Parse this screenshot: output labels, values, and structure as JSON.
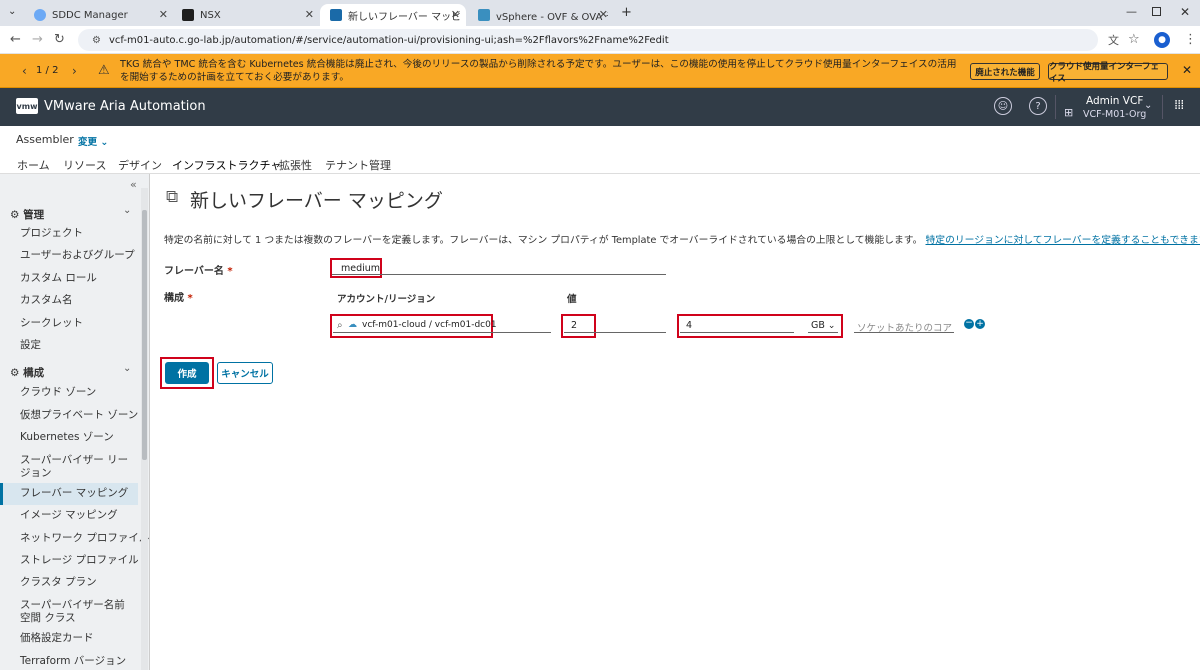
{
  "browser": {
    "tabs": [
      {
        "title": "SDDC Manager",
        "color": "#6ca9f5"
      },
      {
        "title": "NSX",
        "color": "#1e1e1e"
      },
      {
        "title": "新しいフレーバー マッピング - Assem",
        "color": "#1a6aa8"
      },
      {
        "title": "vSphere - OVF & OVA テンプレー",
        "color": "#3a8fbf"
      }
    ],
    "url": "vcf-m01-auto.c.go-lab.jp/automation/#/service/automation-ui/provisioning-ui;ash=%2Fflavors%2Fname%2Fedit"
  },
  "banner": {
    "counter": "1 / 2",
    "message": "TKG 統合や TMC 統合を含む Kubernetes 統合機能は廃止され、今後のリリースの製品から削除される予定です。ユーザーは、この機能の使用を停止してクラウド使用量インターフェイスの活用を開始するための計画を立てておく必要があります。",
    "button1": "廃止された機能",
    "button2": "クラウド使用量インターフェイス"
  },
  "header": {
    "logo": "vmw",
    "title": "VMware Aria Automation",
    "user": "Admin VCF",
    "org": "VCF-M01-Org"
  },
  "service": {
    "name": "Assembler",
    "change": "変更",
    "tabs": [
      "ホーム",
      "リソース",
      "デザイン",
      "インフラストラクチャ",
      "拡張性",
      "テナント管理"
    ]
  },
  "sidebar": {
    "section1": "管理",
    "items1": [
      "プロジェクト",
      "ユーザーおよびグループ",
      "カスタム ロール",
      "カスタム名",
      "シークレット",
      "設定"
    ],
    "section2": "構成",
    "items2": [
      "クラウド ゾーン",
      "仮想プライベート ゾーン",
      "Kubernetes ゾーン",
      "スーパーバイザー リージョン",
      "フレーバー マッピング",
      "イメージ マッピング",
      "ネットワーク プロファイル",
      "ストレージ プロファイル",
      "クラスタ プラン",
      "スーパーバイザー名前空間 クラス",
      "価格設定カード",
      "Terraform バージョン"
    ]
  },
  "form": {
    "title": "新しいフレーバー マッピング",
    "description": "特定の名前に対して 1 つまたは複数のフレーバーを定義します。フレーバーは、マシン プロパティが Template でオーバーライドされている場合の上限として機能します。",
    "link": "特定のリージョンに対してフレーバーを定義することもできます。",
    "flavor_label": "フレーバー名",
    "required": "*",
    "flavor_value": "medium",
    "config_label": "構成",
    "col_account": "アカウント/リージョン",
    "col_value": "値",
    "account_value": "vcf-m01-cloud / vcf-m01-dc01",
    "cpu_value": "2",
    "memory_value": "4",
    "memory_unit": "GB",
    "cores_placeholder": "ソケットあたりのコア",
    "create": "作成",
    "cancel": "キャンセル"
  }
}
